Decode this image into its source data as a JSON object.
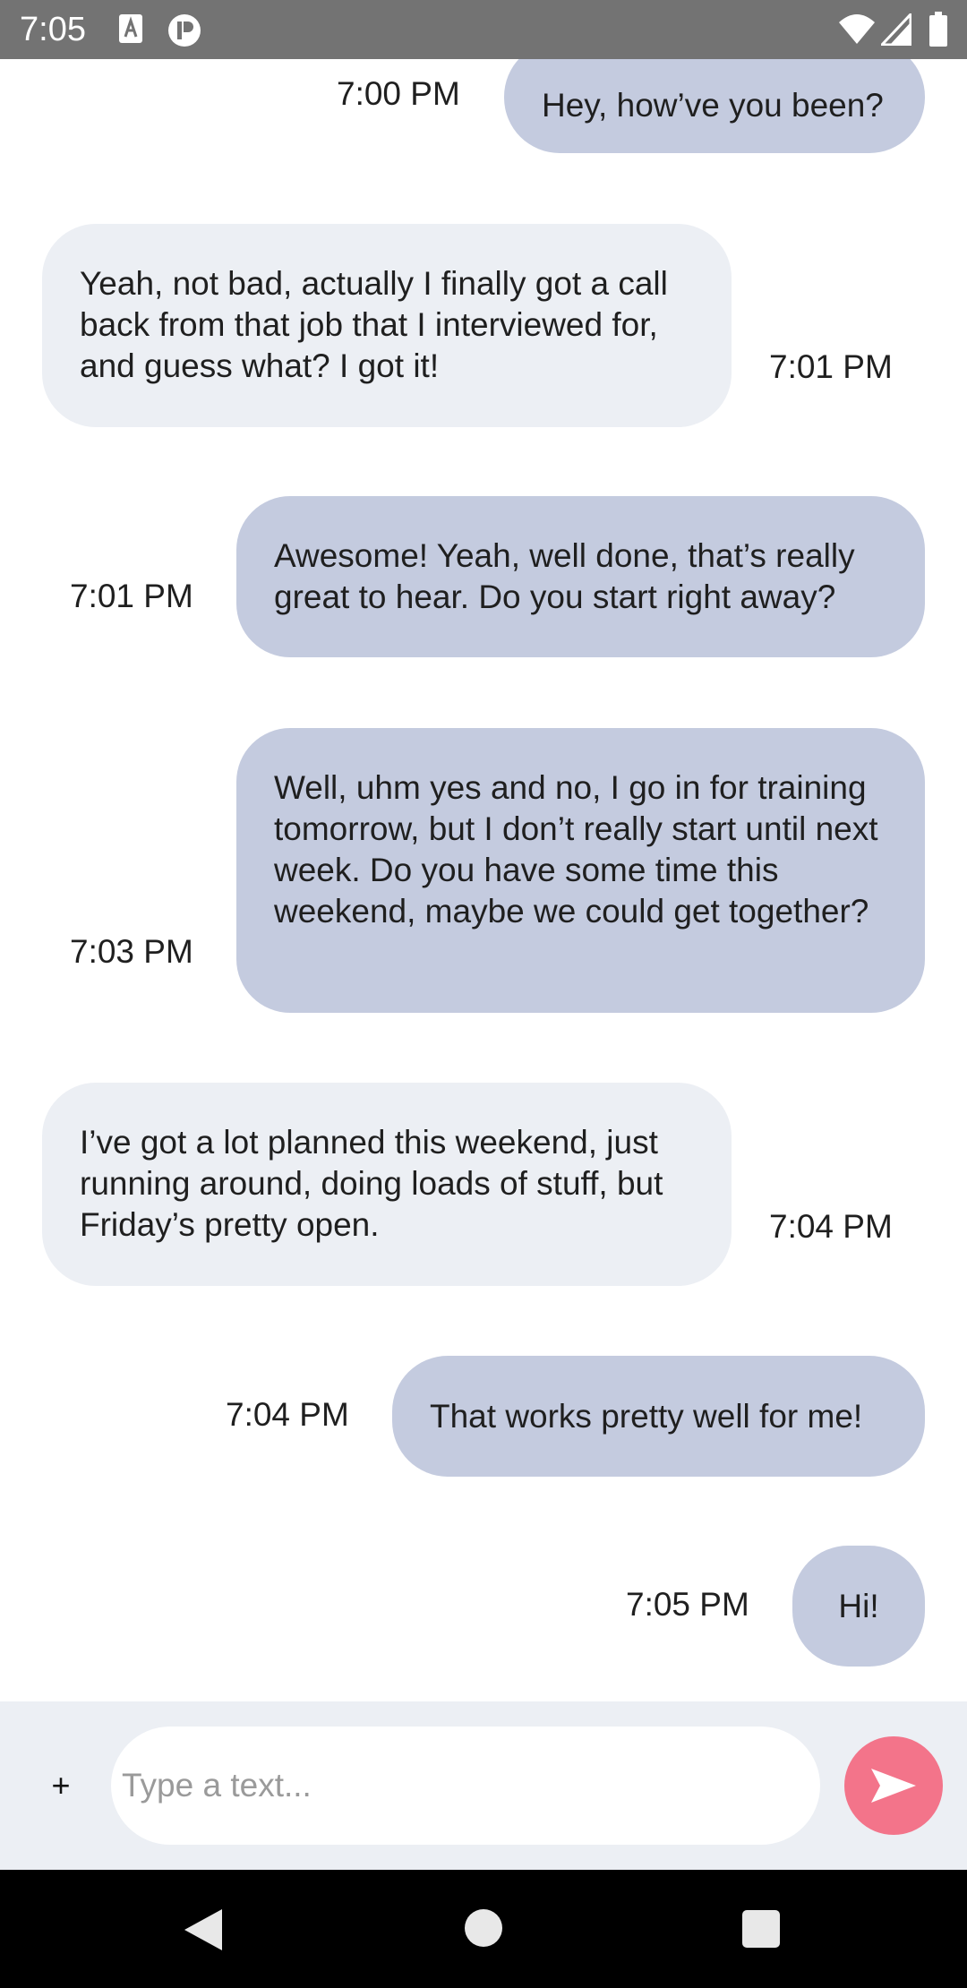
{
  "status_bar": {
    "time": "7:05",
    "icons": [
      "a-notification-icon",
      "p-notification-icon",
      "wifi-icon",
      "signal-icon",
      "battery-icon"
    ]
  },
  "messages": [
    {
      "direction": "sent",
      "text": "Hey, how’ve you been?",
      "time": "7:00 PM"
    },
    {
      "direction": "received",
      "text": "Yeah, not bad, actually I finally got a call back from that job that I interviewed for, and guess what? I got it!",
      "time": "7:01 PM"
    },
    {
      "direction": "sent",
      "text": "Awesome! Yeah, well done, that’s really great to hear. Do you start right away?",
      "time": "7:01 PM"
    },
    {
      "direction": "sent",
      "text": "Well, uhm yes and no, I go in for training tomorrow, but I don’t really start until next week. Do you have some time this weekend, maybe we could get together?",
      "time": "7:03 PM"
    },
    {
      "direction": "received",
      "text": "I’ve got a lot planned this weekend, just running around, doing loads of stuff, but Friday’s pretty open.",
      "time": "7:04 PM"
    },
    {
      "direction": "sent",
      "text": "That works pretty well for me!",
      "time": "7:04 PM"
    },
    {
      "direction": "sent",
      "text": "Hi!",
      "time": "7:05 PM"
    }
  ],
  "composer": {
    "add_label": "+",
    "placeholder": "Type a text...",
    "value": "",
    "send_icon": "send-icon"
  },
  "nav_bar": {
    "icons": [
      "back-icon",
      "home-icon",
      "recents-icon"
    ]
  },
  "colors": {
    "status_bar": "#737373",
    "sent_bubble": "#c4cbdf",
    "received_bubble": "#eceff4",
    "composer_bg": "#eceff4",
    "send_button": "#f3748a",
    "nav_bar": "#000000"
  }
}
